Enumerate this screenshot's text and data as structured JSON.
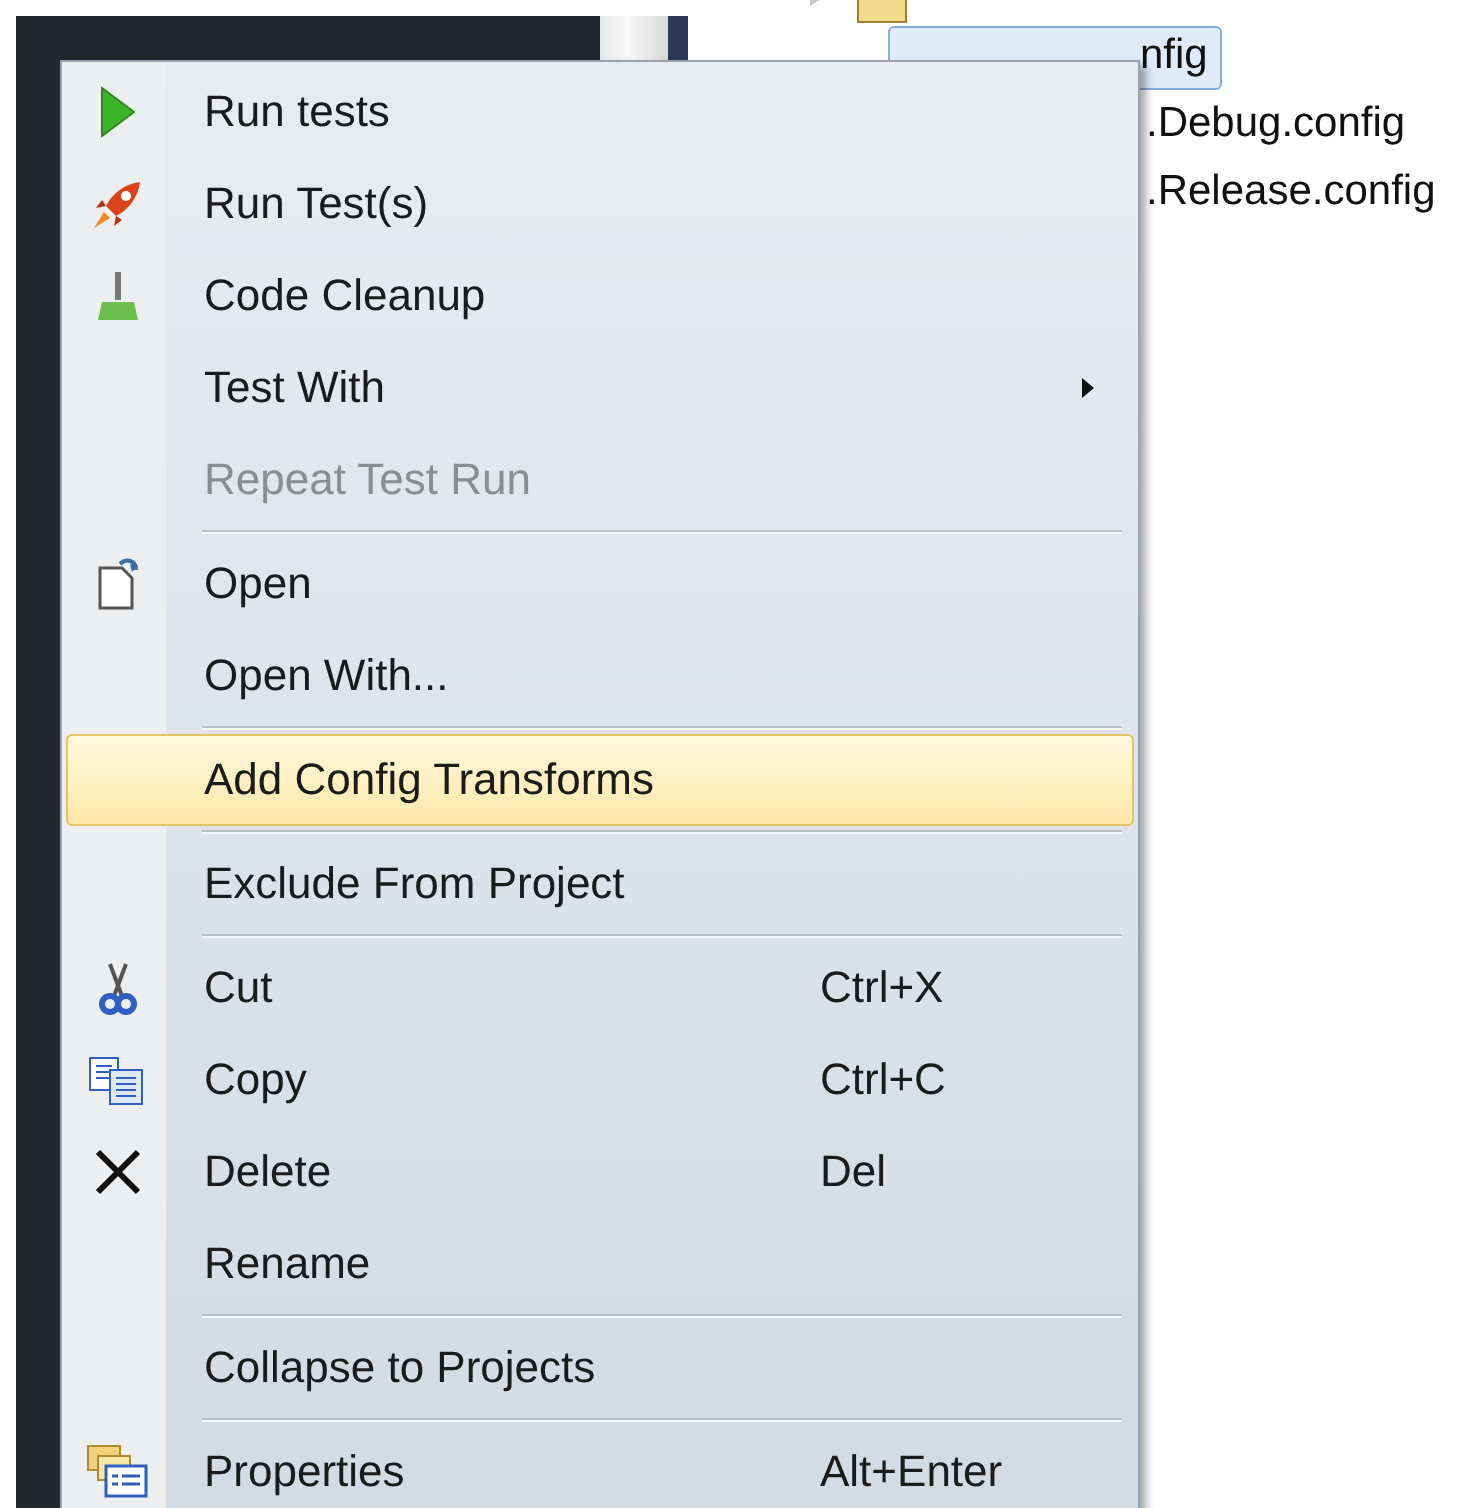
{
  "tree": {
    "items": [
      {
        "label": "nfig",
        "selected": true
      },
      {
        "label": ".Debug.config",
        "selected": false
      },
      {
        "label": ".Release.config",
        "selected": false
      }
    ]
  },
  "context_menu": {
    "items": [
      {
        "kind": "item",
        "label": "Run tests",
        "disabled": false,
        "selected": false,
        "submenu": false
      },
      {
        "kind": "item",
        "label": "Run Test(s)",
        "disabled": false,
        "selected": false,
        "submenu": false
      },
      {
        "kind": "item",
        "label": "Code Cleanup",
        "disabled": false,
        "selected": false,
        "submenu": false
      },
      {
        "kind": "item",
        "label": "Test With",
        "disabled": false,
        "selected": false,
        "submenu": true
      },
      {
        "kind": "item",
        "label": "Repeat Test Run",
        "disabled": true,
        "selected": false,
        "submenu": false
      },
      {
        "kind": "separator"
      },
      {
        "kind": "item",
        "label": "Open",
        "disabled": false,
        "selected": false,
        "submenu": false
      },
      {
        "kind": "item",
        "label": "Open With...",
        "disabled": false,
        "selected": false,
        "submenu": false
      },
      {
        "kind": "separator"
      },
      {
        "kind": "item",
        "label": "Add Config Transforms",
        "disabled": false,
        "selected": true,
        "submenu": false
      },
      {
        "kind": "separator"
      },
      {
        "kind": "item",
        "label": "Exclude From Project",
        "disabled": false,
        "selected": false,
        "submenu": false
      },
      {
        "kind": "separator"
      },
      {
        "kind": "item",
        "label": "Cut",
        "shortcut": "Ctrl+X",
        "disabled": false,
        "selected": false,
        "submenu": false
      },
      {
        "kind": "item",
        "label": "Copy",
        "shortcut": "Ctrl+C",
        "disabled": false,
        "selected": false,
        "submenu": false
      },
      {
        "kind": "item",
        "label": "Delete",
        "shortcut": "Del",
        "disabled": false,
        "selected": false,
        "submenu": false
      },
      {
        "kind": "item",
        "label": "Rename",
        "disabled": false,
        "selected": false,
        "submenu": false
      },
      {
        "kind": "separator"
      },
      {
        "kind": "item",
        "label": "Collapse to Projects",
        "disabled": false,
        "selected": false,
        "submenu": false
      },
      {
        "kind": "separator"
      },
      {
        "kind": "item",
        "label": "Properties",
        "shortcut": "Alt+Enter",
        "disabled": false,
        "selected": false,
        "submenu": false
      }
    ]
  }
}
